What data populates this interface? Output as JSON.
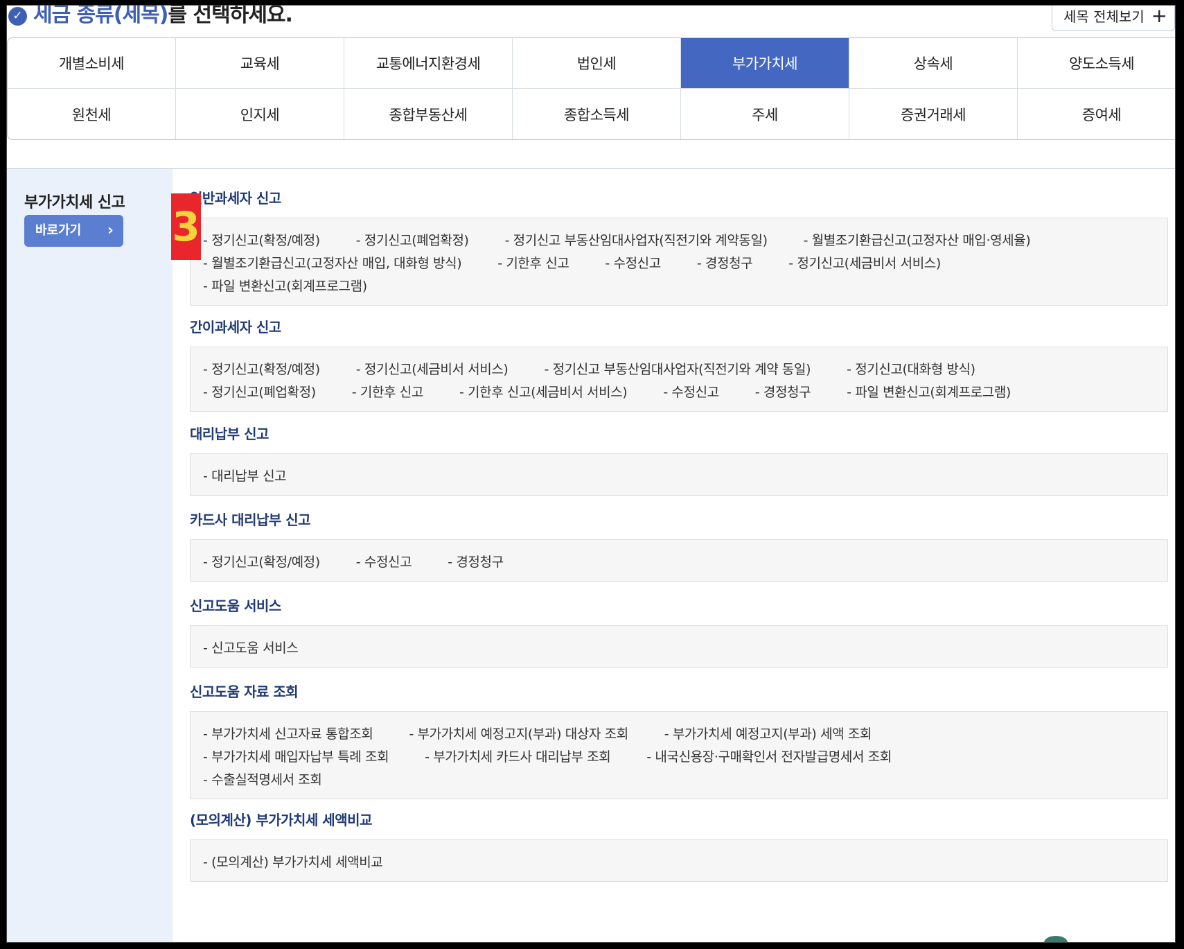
{
  "header": {
    "title_emph": "세금 종류(세목)",
    "title_rest": "를 선택하세요.",
    "view_all_label": "세목 전체보기",
    "view_all_icon": "+"
  },
  "tabs": [
    {
      "label": "개별소비세"
    },
    {
      "label": "교육세"
    },
    {
      "label": "교통에너지환경세"
    },
    {
      "label": "법인세"
    },
    {
      "label": "부가가치세",
      "active": true
    },
    {
      "label": "상속세"
    },
    {
      "label": "양도소득세"
    },
    {
      "label": "원천세"
    },
    {
      "label": "인지세"
    },
    {
      "label": "종합부동산세"
    },
    {
      "label": "종합소득세"
    },
    {
      "label": "주세"
    },
    {
      "label": "증권거래세"
    },
    {
      "label": "증여세"
    }
  ],
  "sidebar": {
    "title": "부가가치세 신고",
    "go_label": "바로가기",
    "go_icon": "›"
  },
  "badge": "3",
  "sections": [
    {
      "title": "일반과세자 신고",
      "rows": [
        [
          "정기신고(확정/예정)",
          "정기신고(폐업확정)",
          "정기신고 부동산임대사업자(직전기와 계약동일)",
          "월별조기환급신고(고정자산 매입·영세율)"
        ],
        [
          "월별조기환급신고(고정자산 매입, 대화형 방식)",
          "기한후 신고",
          "수정신고",
          "경정청구",
          "정기신고(세금비서 서비스)"
        ],
        [
          "파일 변환신고(회계프로그램)"
        ]
      ]
    },
    {
      "title": "간이과세자 신고",
      "rows": [
        [
          "정기신고(확정/예정)",
          "정기신고(세금비서 서비스)",
          "정기신고 부동산임대사업자(직전기와 계약 동일)",
          "정기신고(대화형 방식)"
        ],
        [
          "정기신고(폐업확정)",
          "기한후 신고",
          "기한후 신고(세금비서 서비스)",
          "수정신고",
          "경정청구",
          "파일 변환신고(회계프로그램)"
        ]
      ]
    },
    {
      "title": "대리납부 신고",
      "rows": [
        [
          "대리납부 신고"
        ]
      ]
    },
    {
      "title": "카드사 대리납부 신고",
      "rows": [
        [
          "정기신고(확정/예정)",
          "수정신고",
          "경정청구"
        ]
      ]
    },
    {
      "title": "신고도움 서비스",
      "rows": [
        [
          "신고도움 서비스"
        ]
      ]
    },
    {
      "title": "신고도움 자료 조회",
      "rows": [
        [
          "부가가치세 신고자료 통합조회",
          "부가가치세 예정고지(부과) 대상자 조회",
          "부가가치세 예정고지(부과) 세액 조회"
        ],
        [
          "부가가치세 매입자납부 특례 조회",
          "부가가치세 카드사 대리납부 조회",
          "내국신용장·구매확인서 전자발급명세서 조회"
        ],
        [
          "수출실적명세서 조회"
        ]
      ]
    },
    {
      "title": "(모의계산) 부가가치세 세액비교",
      "rows": [
        [
          "(모의계산) 부가가치세 세액비교"
        ]
      ]
    }
  ]
}
